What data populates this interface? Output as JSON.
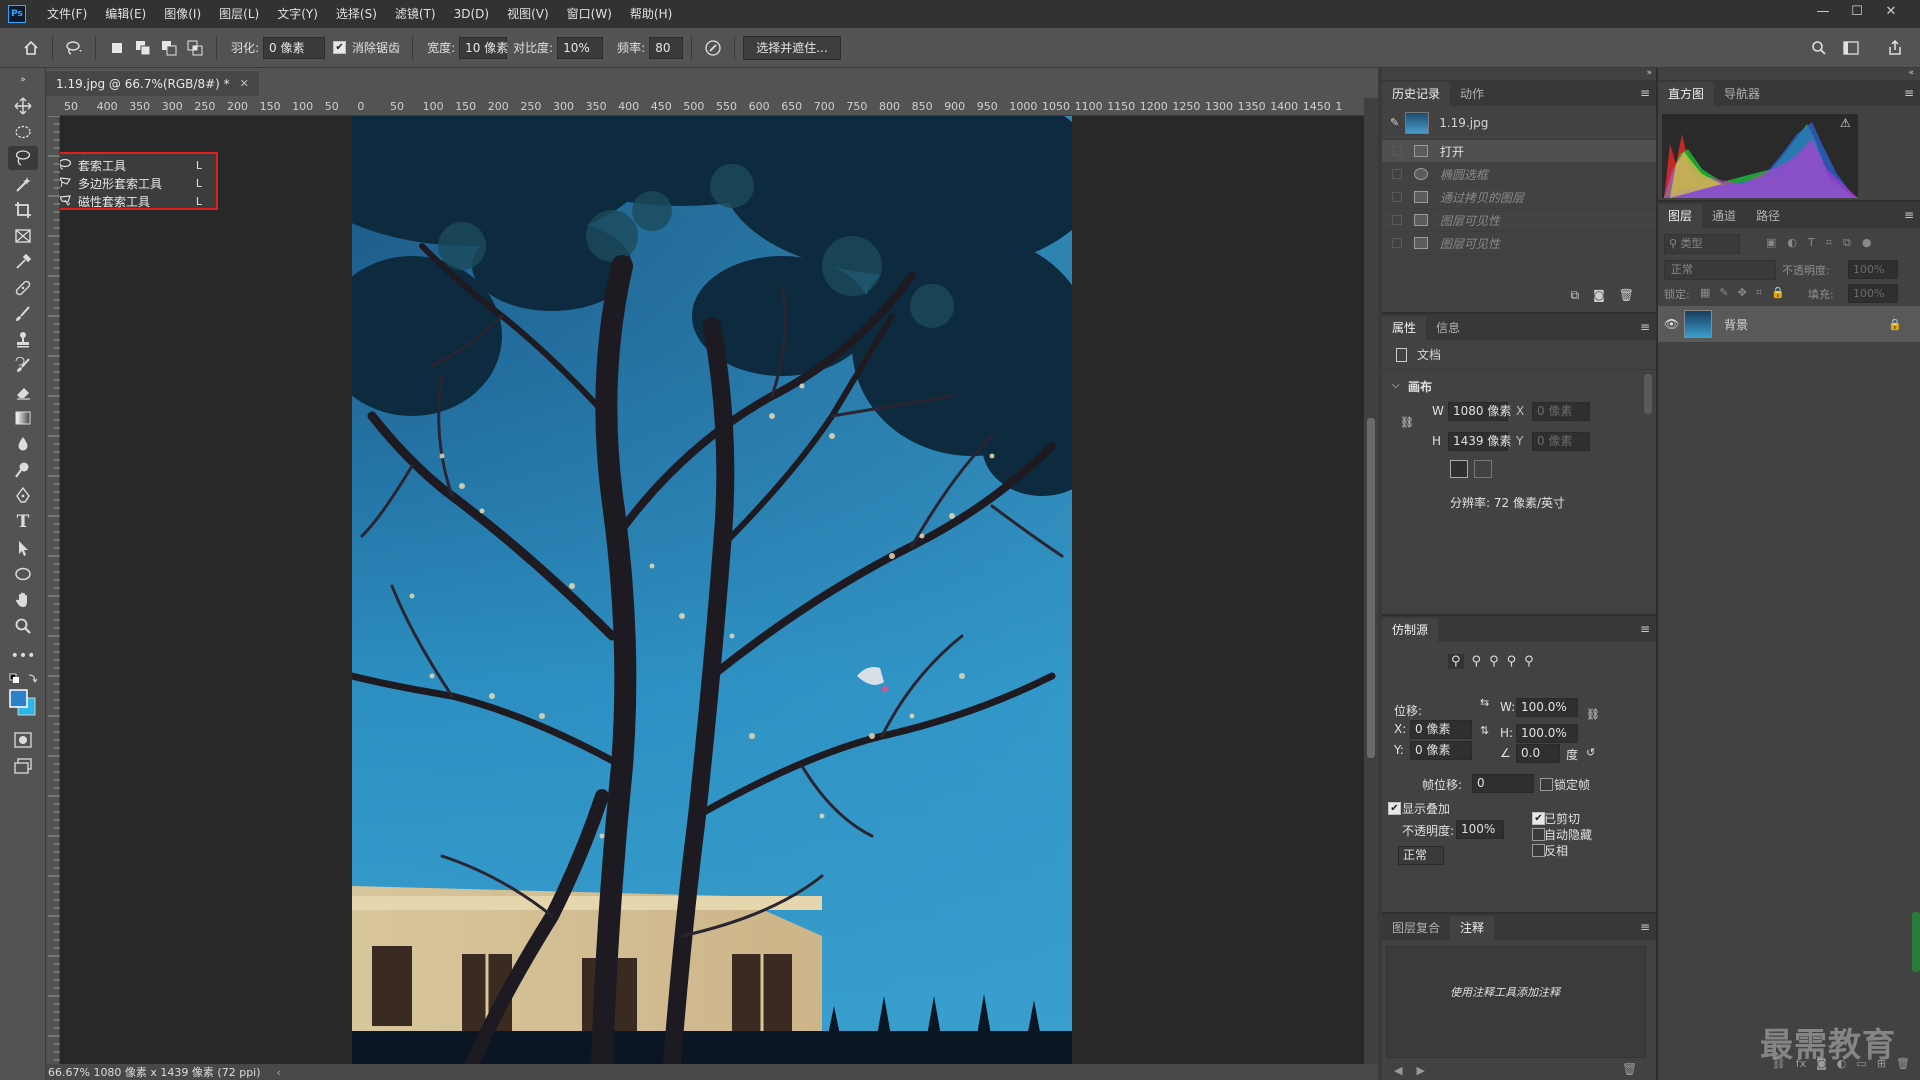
{
  "app": {
    "logo": "Ps",
    "menus": [
      "文件(F)",
      "编辑(E)",
      "图像(I)",
      "图层(L)",
      "文字(Y)",
      "选择(S)",
      "滤镜(T)",
      "3D(D)",
      "视图(V)",
      "窗口(W)",
      "帮助(H)"
    ]
  },
  "options": {
    "feather_label": "羽化:",
    "feather_value": "0 像素",
    "antialias_label": "消除锯齿",
    "antialias_checked": true,
    "width_label": "宽度:",
    "width_value": "10 像素",
    "contrast_label": "对比度:",
    "contrast_value": "10%",
    "frequency_label": "频率:",
    "frequency_value": "80",
    "select_mask_label": "选择并遮住..."
  },
  "document": {
    "tab_title": "1.19.jpg @ 66.7%(RGB/8#) *",
    "status": "66.67%   1080 像素 x 1439 像素 (72 ppi)"
  },
  "ruler": {
    "top_labels": [
      "50",
      "400",
      "350",
      "300",
      "250",
      "200",
      "150",
      "100",
      "50",
      "0",
      "50",
      "100",
      "150",
      "200",
      "250",
      "300",
      "350",
      "400",
      "450",
      "500",
      "550",
      "600",
      "650",
      "700",
      "750",
      "800",
      "850",
      "900",
      "950",
      "1000",
      "1050",
      "1100",
      "1150",
      "1200",
      "1250",
      "1300",
      "1350",
      "1400",
      "1450",
      "1"
    ]
  },
  "flyout": {
    "items": [
      {
        "label": "套索工具",
        "key": "L"
      },
      {
        "label": "多边形套索工具",
        "key": "L"
      },
      {
        "label": "磁性套索工具",
        "key": "L"
      }
    ]
  },
  "history_panel": {
    "tabs": [
      "历史记录",
      "动作"
    ],
    "snapshot": "1.19.jpg",
    "items": [
      {
        "label": "打开",
        "state": "selected"
      },
      {
        "label": "椭圆选框",
        "state": "dim"
      },
      {
        "label": "通过拷贝的图层",
        "state": "dim"
      },
      {
        "label": "图层可见性",
        "state": "dim"
      },
      {
        "label": "图层可见性",
        "state": "dim"
      }
    ]
  },
  "properties_panel": {
    "tabs": [
      "属性",
      "信息"
    ],
    "doc_label": "文档",
    "canvas_label": "画布",
    "w_label": "W",
    "w_value": "1080 像素",
    "h_label": "H",
    "h_value": "1439 像素",
    "x_label": "X",
    "x_value": "0 像素",
    "y_label": "Y",
    "y_value": "0 像素",
    "resolution": "分辨率: 72 像素/英寸"
  },
  "clone_panel": {
    "tab": "仿制源",
    "offset_label": "位移:",
    "x_label": "X:",
    "x_value": "0 像素",
    "y_label": "Y:",
    "y_value": "0 像素",
    "w_label": "W:",
    "w_value": "100.0%",
    "h_label": "H:",
    "h_value": "100.0%",
    "angle_value": "0.0",
    "angle_unit": "度",
    "frame_offset_label": "帧位移:",
    "frame_offset_value": "0",
    "lock_frame_label": "锁定帧",
    "show_overlay_label": "显示叠加",
    "opacity_label": "不透明度:",
    "opacity_value": "100%",
    "blend_mode": "正常",
    "clipped_label": "已剪切",
    "auto_hide_label": "自动隐藏",
    "invert_label": "反相"
  },
  "notes_panel": {
    "tabs": [
      "图层复合",
      "注释"
    ],
    "hint": "使用注释工具添加注释"
  },
  "histogram_panel": {
    "tabs": [
      "直方图",
      "导航器"
    ]
  },
  "layers_panel": {
    "tabs": [
      "图层",
      "通道",
      "路径"
    ],
    "filter_placeholder": "类型",
    "blend_mode": "正常",
    "opacity_label": "不透明度:",
    "opacity_value": "100%",
    "lock_label": "锁定:",
    "fill_label": "填充:",
    "fill_value": "100%",
    "layer_name": "背景"
  },
  "watermark": "最需教育",
  "colors": {
    "accent": "#31a8ff",
    "highlight": "#e02020"
  }
}
